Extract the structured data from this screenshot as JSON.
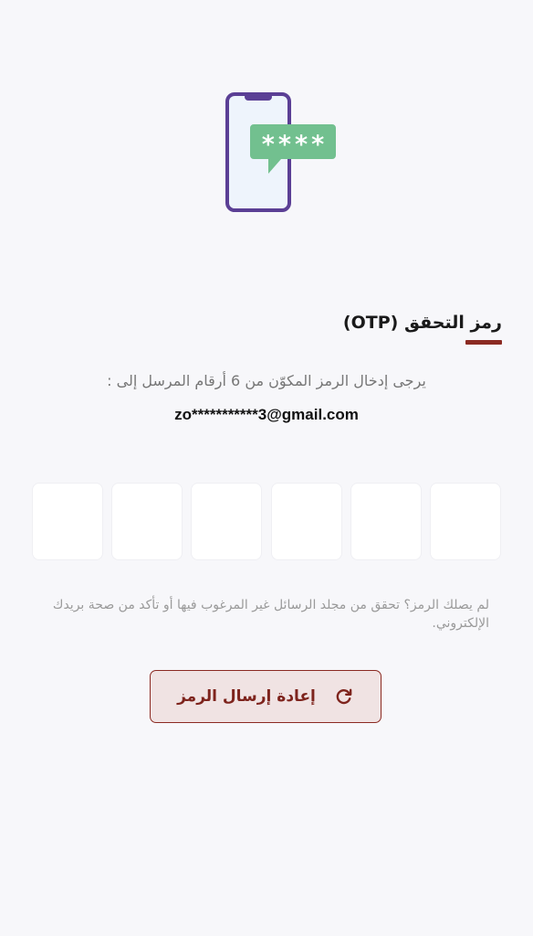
{
  "otp": {
    "title": "رمز التحقق (OTP)",
    "instruction": "يرجى إدخال الرمز المكوّن من 6 أرقام المرسل إلى :",
    "email": "zo***********3@gmail.com",
    "code_length": 6,
    "illustration_text": "****",
    "hint": "لم يصلك الرمز؟ تحقق من مجلد الرسائل غير المرغوب فيها أو تأكد من صحة بريدك الإلكتروني.",
    "resend_label": "إعادة إرسال الرمز"
  },
  "icons": {
    "phone": "phone-otp-icon",
    "resend": "refresh-icon"
  },
  "colors": {
    "accent": "#8b2a22",
    "phone_frame": "#5b3f95",
    "message_bubble": "#72c08f",
    "button_bg": "#f0e3e3"
  }
}
